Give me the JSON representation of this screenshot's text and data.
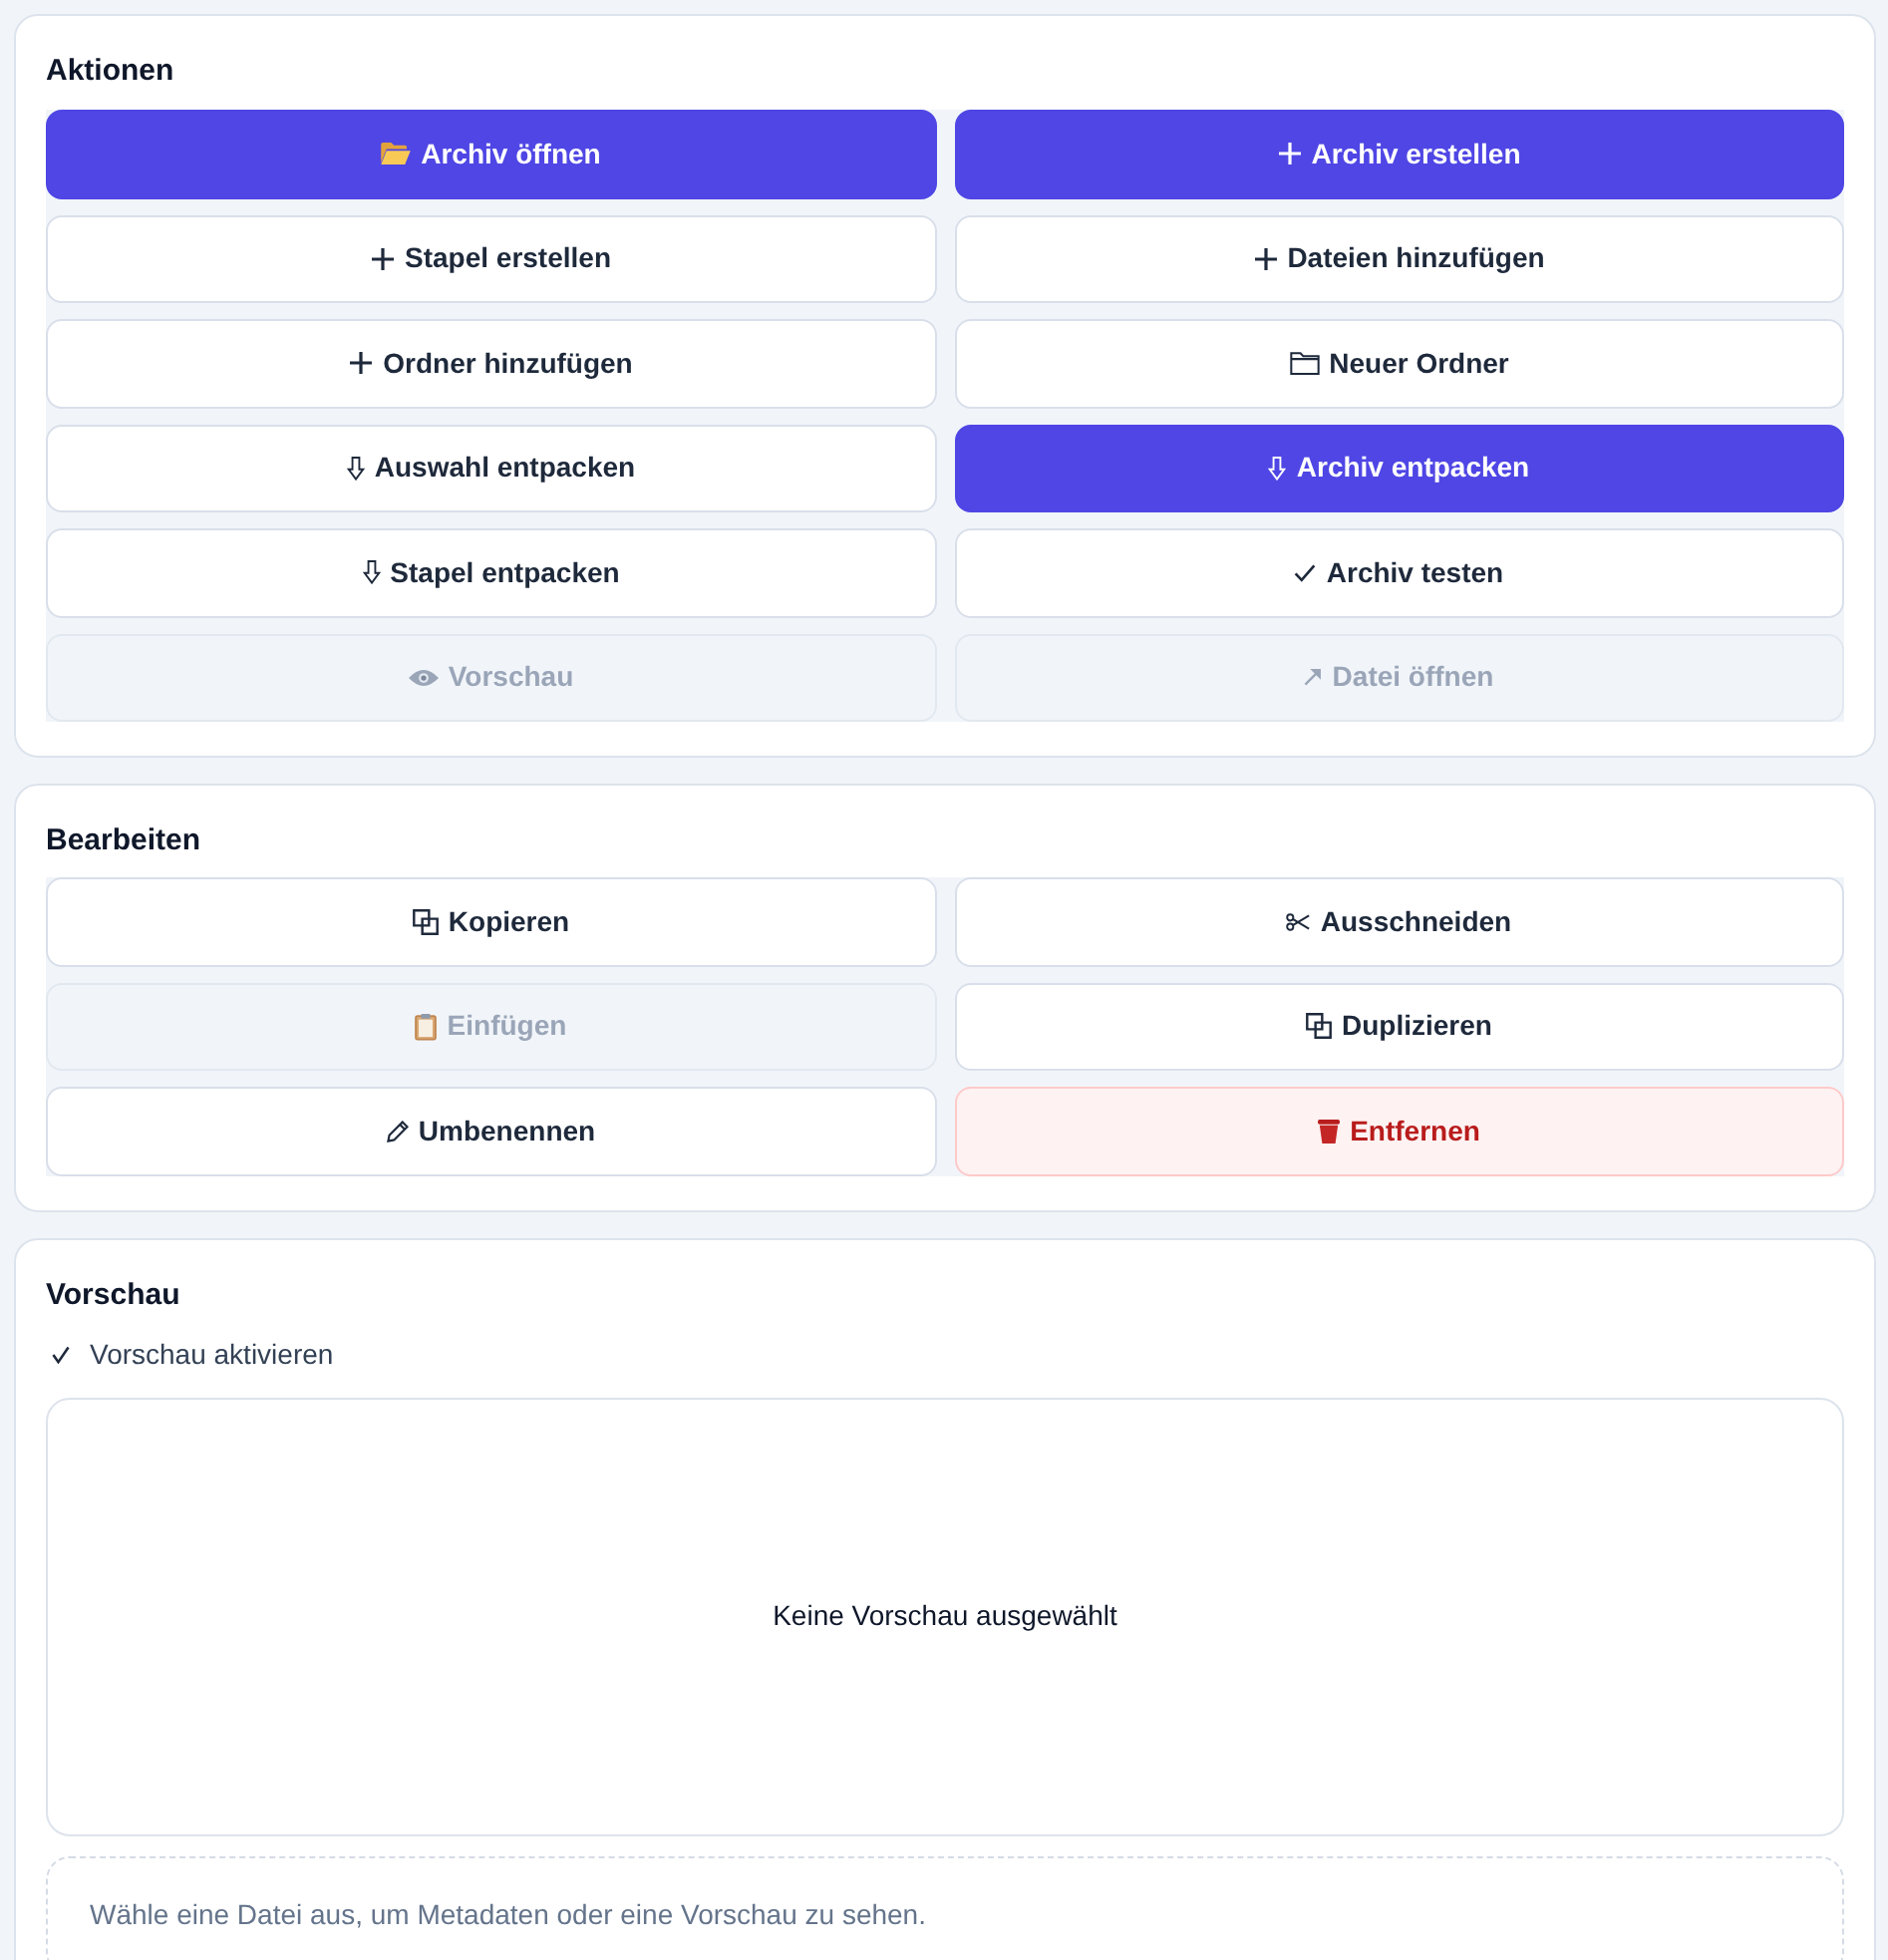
{
  "actions": {
    "title": "Aktionen",
    "buttons": [
      {
        "label": "Archiv öffnen",
        "kind": "primary",
        "disabled": false
      },
      {
        "label": "Archiv erstellen",
        "kind": "primary",
        "disabled": false
      },
      {
        "label": "Stapel erstellen",
        "kind": "secondary",
        "disabled": false
      },
      {
        "label": "Dateien hinzufügen",
        "kind": "secondary",
        "disabled": false
      },
      {
        "label": "Ordner hinzufügen",
        "kind": "secondary",
        "disabled": false
      },
      {
        "label": "Neuer Ordner",
        "kind": "secondary",
        "disabled": false
      },
      {
        "label": "Auswahl entpacken",
        "kind": "secondary",
        "disabled": false
      },
      {
        "label": "Archiv entpacken",
        "kind": "primary",
        "disabled": false
      },
      {
        "label": "Stapel entpacken",
        "kind": "secondary",
        "disabled": false
      },
      {
        "label": "Archiv testen",
        "kind": "secondary",
        "disabled": false
      },
      {
        "label": "Vorschau",
        "kind": "secondary",
        "disabled": true
      },
      {
        "label": "Datei öffnen",
        "kind": "secondary",
        "disabled": true
      }
    ]
  },
  "edit": {
    "title": "Bearbeiten",
    "buttons": [
      {
        "label": "Kopieren",
        "kind": "secondary",
        "disabled": false
      },
      {
        "label": "Ausschneiden",
        "kind": "secondary",
        "disabled": false
      },
      {
        "label": "Einfügen",
        "kind": "secondary",
        "disabled": true
      },
      {
        "label": "Duplizieren",
        "kind": "secondary",
        "disabled": false
      },
      {
        "label": "Umbenennen",
        "kind": "secondary",
        "disabled": false
      },
      {
        "label": "Entfernen",
        "kind": "danger",
        "disabled": false
      }
    ]
  },
  "preview": {
    "title": "Vorschau",
    "toggle": {
      "label": "Vorschau aktivieren",
      "checked": true
    },
    "empty_text": "Keine Vorschau ausgewählt",
    "hint": "Wähle eine Datei aus, um Metadaten oder eine Vorschau zu sehen."
  }
}
